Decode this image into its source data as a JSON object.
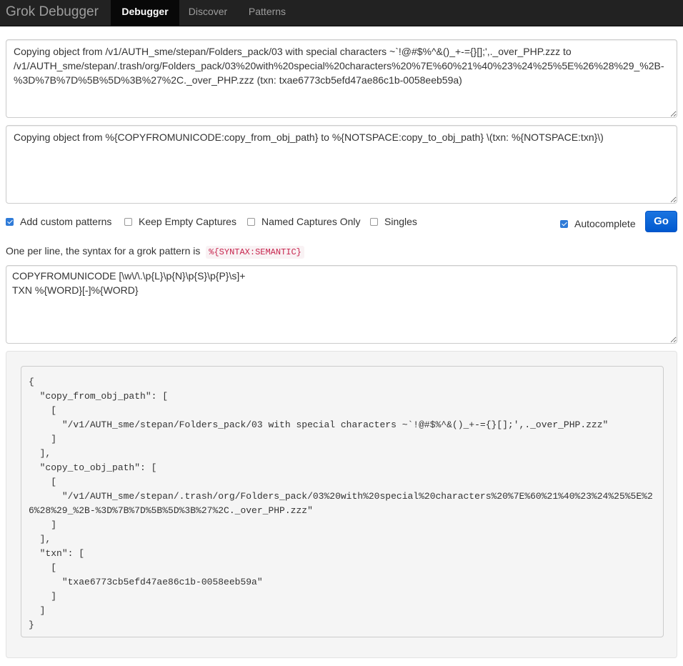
{
  "nav": {
    "brand": "Grok Debugger",
    "items": [
      {
        "label": "Debugger",
        "active": true
      },
      {
        "label": "Discover",
        "active": false
      },
      {
        "label": "Patterns",
        "active": false
      }
    ]
  },
  "sample_input": "Copying object from /v1/AUTH_sme/stepan/Folders_pack/03 with special characters ~`!@#$%^&()_+-={}[];',._over_PHP.zzz to /v1/AUTH_sme/stepan/.trash/org/Folders_pack/03%20with%20special%20characters%20%7E%60%21%40%23%24%25%5E%26%28%29_%2B-%3D%7B%7D%5B%5D%3B%27%2C._over_PHP.zzz (txn: txae6773cb5efd47ae86c1b-0058eeb59a)",
  "pattern_input": "Copying object from %{COPYFROMUNICODE:copy_from_obj_path} to %{NOTSPACE:copy_to_obj_path} \\(txn: %{NOTSPACE:txn}\\)",
  "options": {
    "add_custom_patterns": {
      "label": "Add custom patterns",
      "checked": true
    },
    "keep_empty_captures": {
      "label": "Keep Empty Captures",
      "checked": false
    },
    "named_captures_only": {
      "label": "Named Captures Only",
      "checked": false
    },
    "singles": {
      "label": "Singles",
      "checked": false
    },
    "autocomplete": {
      "label": "Autocomplete",
      "checked": true
    }
  },
  "go_label": "Go",
  "hint": {
    "text": "One per line, the syntax for a grok pattern is",
    "code": "%{SYNTAX:SEMANTIC}"
  },
  "custom_patterns": "COPYFROMUNICODE [\\w\\/\\.\\p{L}\\p{N}\\p{S}\\p{P}\\s]+\nTXN %{WORD}[-]%{WORD}",
  "result": "{\n  \"copy_from_obj_path\": [\n    [\n      \"/v1/AUTH_sme/stepan/Folders_pack/03 with special characters ~`!@#$%^&()_+-={}[];',._over_PHP.zzz\"\n    ]\n  ],\n  \"copy_to_obj_path\": [\n    [\n      \"/v1/AUTH_sme/stepan/.trash/org/Folders_pack/03%20with%20special%20characters%20%7E%60%21%40%23%24%25%5E%26%28%29_%2B-%3D%7B%7D%5B%5D%3B%27%2C._over_PHP.zzz\"\n    ]\n  ],\n  \"txn\": [\n    [\n      \"txae6773cb5efd47ae86c1b-0058eeb59a\"\n    ]\n  ]\n}"
}
